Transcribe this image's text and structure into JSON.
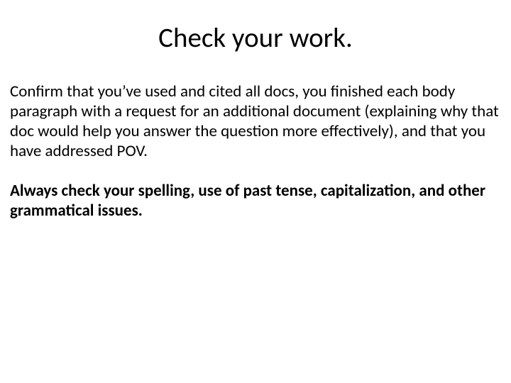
{
  "slide": {
    "title": "Check your work.",
    "paragraph1": "Confirm that you’ve used and cited all docs, you finished each body paragraph with a request for an additional document (explaining why that doc would help you answer the question more effectively), and that you have addressed POV.",
    "paragraph2": "Always check your spelling, use of past tense, capitalization, and other grammatical issues."
  }
}
